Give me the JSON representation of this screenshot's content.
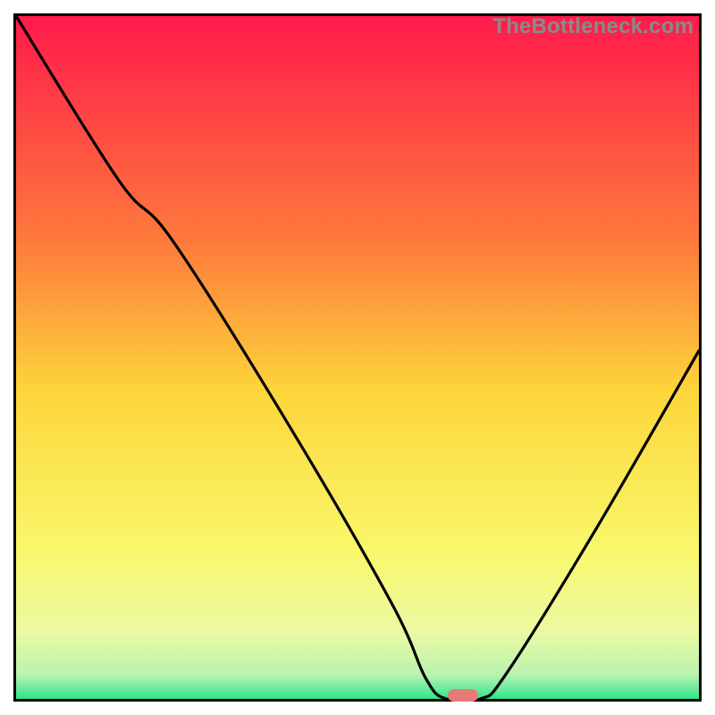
{
  "watermark": {
    "text": "TheBottleneck.com"
  },
  "chart_data": {
    "type": "line",
    "title": "",
    "xlabel": "",
    "ylabel": "",
    "xlim": [
      0,
      100
    ],
    "ylim": [
      0,
      100
    ],
    "grid": false,
    "legend": false,
    "background_gradient": {
      "stops": [
        {
          "offset": 0,
          "color": "#ff1a4b"
        },
        {
          "offset": 0.33,
          "color": "#fe7a3c"
        },
        {
          "offset": 0.55,
          "color": "#fdd53b"
        },
        {
          "offset": 0.78,
          "color": "#f9f76b"
        },
        {
          "offset": 0.9,
          "color": "#edf9a2"
        },
        {
          "offset": 0.965,
          "color": "#b9f3b0"
        },
        {
          "offset": 1.0,
          "color": "#2fe58d"
        }
      ]
    },
    "series": [
      {
        "name": "bottleneck-curve",
        "x": [
          0,
          15,
          23,
          40,
          55,
          60,
          63,
          68,
          72,
          85,
          100
        ],
        "values": [
          100,
          76,
          67,
          40,
          14,
          3,
          0,
          0,
          4,
          25,
          51
        ]
      }
    ],
    "marker": {
      "x": 65.5,
      "y": 0,
      "color": "#e77a78"
    }
  }
}
